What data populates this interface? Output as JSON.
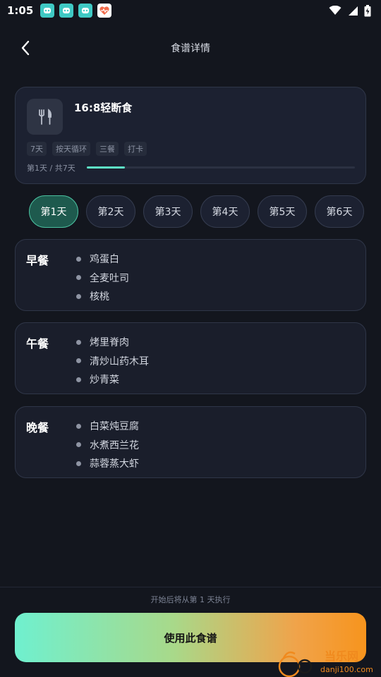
{
  "status_bar": {
    "time": "1:05",
    "notification_icons": [
      "app-notification-icon",
      "app-notification-icon",
      "app-notification-icon",
      "health-app-icon"
    ],
    "status_icons": [
      "wifi-icon",
      "signal-icon",
      "battery-icon"
    ]
  },
  "header": {
    "title": "食谱详情",
    "back_icon": "chevron-left-icon"
  },
  "plan": {
    "icon": "fork-knife-icon",
    "name": "16:8轻断食",
    "tags": [
      "7天",
      "按天循环",
      "三餐",
      "打卡"
    ],
    "progress_label": "第1天 / 共7天",
    "progress": 0.143,
    "accent_color": "#5ee3c6"
  },
  "days": {
    "selected": "第1天",
    "items": [
      "第1天",
      "第2天",
      "第3天",
      "第4天",
      "第5天",
      "第6天"
    ]
  },
  "meals": [
    {
      "title": "早餐",
      "items": [
        "鸡蛋白",
        "全麦吐司",
        "核桃"
      ]
    },
    {
      "title": "午餐",
      "items": [
        "烤里脊肉",
        "清炒山药木耳",
        "炒青菜"
      ]
    },
    {
      "title": "晚餐",
      "items": [
        "白菜炖豆腐",
        "水煮西兰花",
        "蒜蓉蒸大虾"
      ]
    }
  ],
  "footer": {
    "hint": "开始后将从第 1 天执行",
    "cta_label": "使用此食谱"
  },
  "watermark": {
    "line1": "当乐网",
    "line2": "danji100.com"
  }
}
